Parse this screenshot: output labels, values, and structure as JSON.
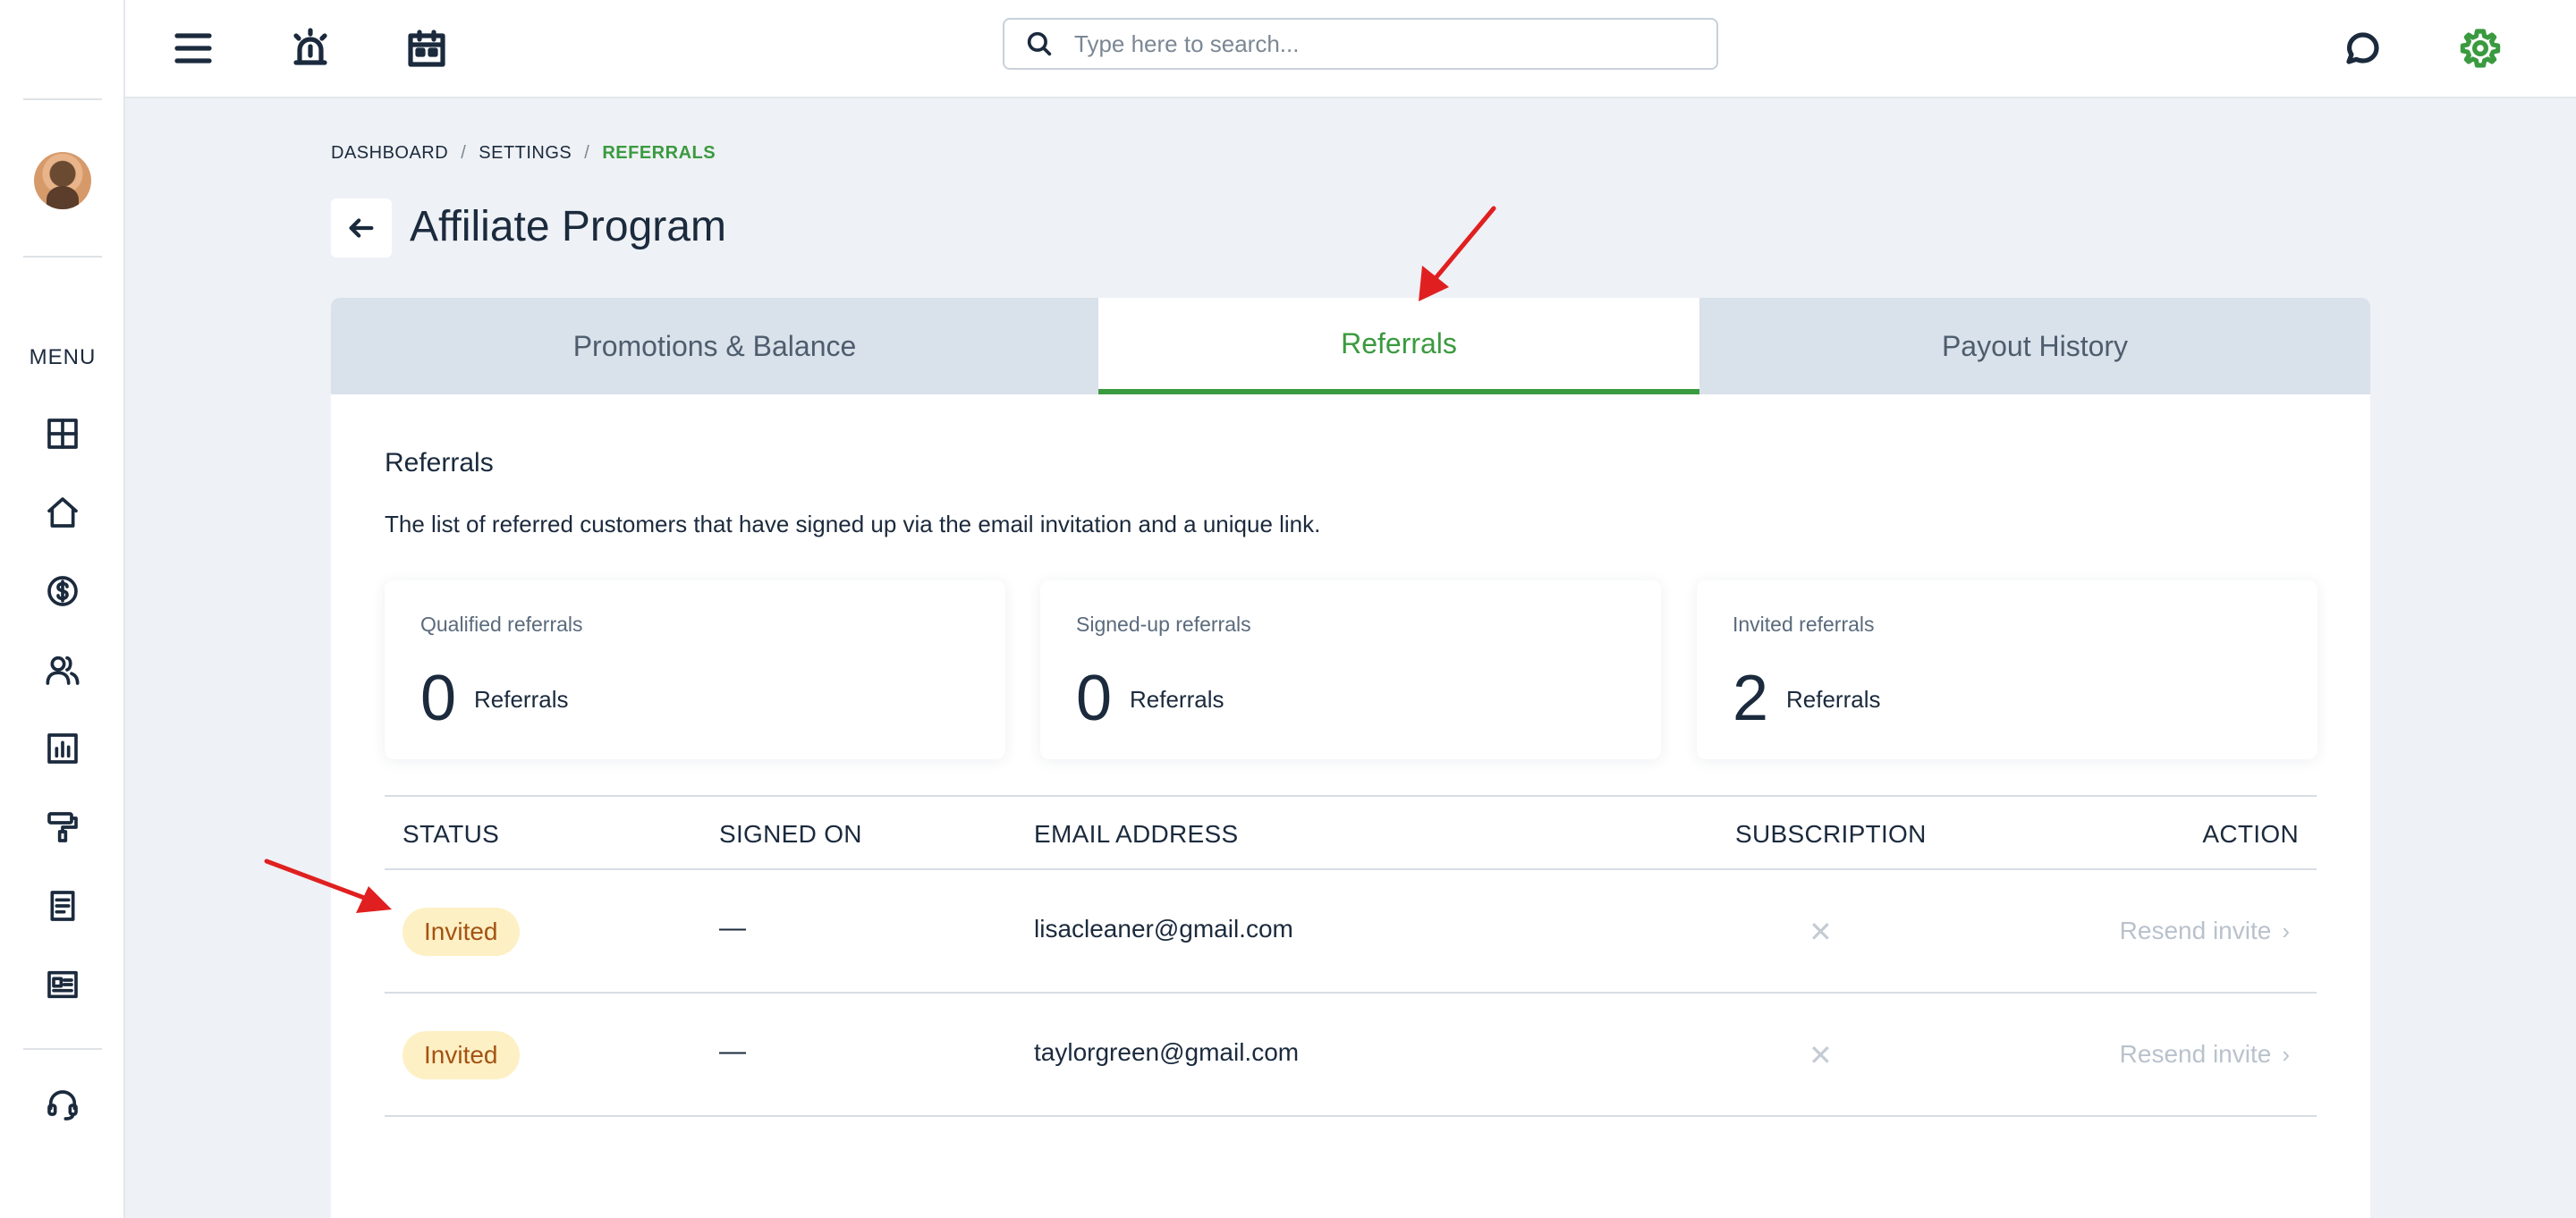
{
  "topbar": {
    "search_placeholder": "Type here to search..."
  },
  "sidebar": {
    "menu_label": "MENU",
    "items": [
      "dashboard-icon",
      "home-icon",
      "dollar-icon",
      "users-icon",
      "chart-icon",
      "paint-roller-icon",
      "document-icon",
      "news-icon"
    ],
    "support_icon": "headset-icon"
  },
  "breadcrumb": {
    "items": [
      "DASHBOARD",
      "SETTINGS",
      "REFERRALS"
    ],
    "separator": "/"
  },
  "page": {
    "title": "Affiliate Program"
  },
  "tabs": [
    {
      "label": "Promotions & Balance",
      "active": false
    },
    {
      "label": "Referrals",
      "active": true
    },
    {
      "label": "Payout History",
      "active": false
    }
  ],
  "referrals": {
    "title": "Referrals",
    "description": "The list of referred customers that have signed up via the email invitation and a unique link."
  },
  "stats": [
    {
      "label": "Qualified referrals",
      "value": "0",
      "unit": "Referrals"
    },
    {
      "label": "Signed-up referrals",
      "value": "0",
      "unit": "Referrals"
    },
    {
      "label": "Invited referrals",
      "value": "2",
      "unit": "Referrals"
    }
  ],
  "table": {
    "headers": {
      "status": "STATUS",
      "signed_on": "SIGNED ON",
      "email": "EMAIL ADDRESS",
      "subscription": "SUBSCRIPTION",
      "action": "ACTION"
    },
    "rows": [
      {
        "status": "Invited",
        "signed_on": "—",
        "email": "lisacleaner@gmail.com",
        "subscription": "✕",
        "action": "Resend invite"
      },
      {
        "status": "Invited",
        "signed_on": "—",
        "email": "taylorgreen@gmail.com",
        "subscription": "✕",
        "action": "Resend invite"
      }
    ]
  },
  "colors": {
    "accent": "#3a9a3f",
    "badge_bg": "#fdf0c4",
    "badge_text": "#a45312",
    "annotation_arrow": "#e02020"
  }
}
